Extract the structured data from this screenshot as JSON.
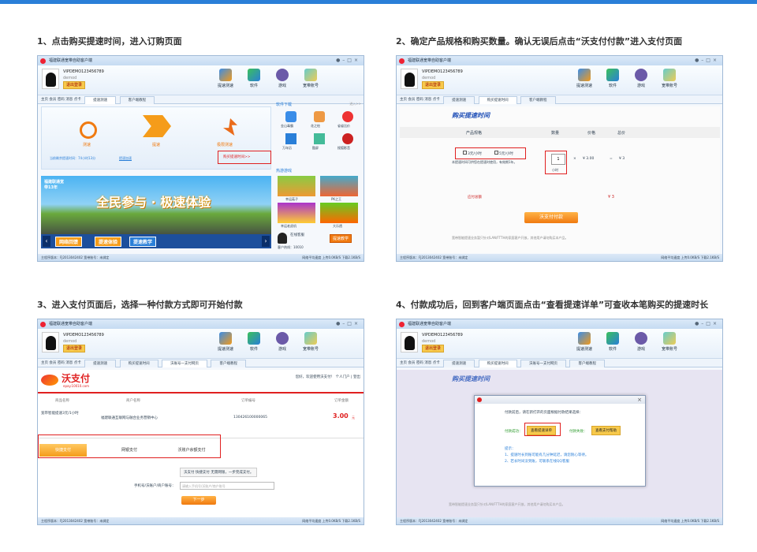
{
  "captions": {
    "step1": "1、点击购买提速时间，进入订购页面",
    "step2": "2、确定产品规格和购买数量。确认无误后点击“沃支付付款”进入支付页面",
    "step3": "3、进入支付页面后，选择一种付款方式即可开始付款",
    "step4": "4、付款成功后，回到客户端页面点击“查看提速详单”可查收本笔购买的提速时长"
  },
  "client": {
    "window_title": "福建联通宽带自助客户端",
    "account": "VIPDEMO123456789",
    "account_sub": "demod",
    "login_label": "退出登录",
    "toolbar": [
      "提速测速",
      "软件",
      "游戏",
      "宽带账号"
    ],
    "nav_links": "主页 会员 密码 消息 点卡",
    "tabs": {
      "speed_test": "提速测速",
      "customer_info": "客户端教程",
      "buy_speed_time": "购买提速时间",
      "wo_pay": "沃账号一支付网页"
    },
    "statusbar_left": "主程序版本：FJ2013042402   宽带账号：未绑定",
    "statusbar_right": "网络平均速度 上传0.0KB/S 下载2.1KB/S"
  },
  "screen1": {
    "test_label": "测速",
    "speedup_label": "提速",
    "max_label": "极限测速",
    "current_time": "当前剩余提速时间：74小时13分",
    "buy_link": "提速加速",
    "buy_btn": "购买提速时间>>",
    "software_title": "软件下载",
    "more": "进入>>",
    "apps": [
      "金山毒霸",
      "花之绘",
      "省省比价",
      "万年历",
      "酷屏",
      "搜狐影音"
    ],
    "banner_text": "全民参与 · 极速体验",
    "banner_tag": "福建联通宽带13年",
    "games_title": "热游游戏",
    "games": [
      "幸运菇子",
      "PK之王",
      "幸运老虎机",
      "大乐透"
    ],
    "bottom_btns": [
      "网络回馈",
      "提速体验",
      "提速教学"
    ],
    "service": "在线客服",
    "hotline": "客户热线：10010"
  },
  "screen2": {
    "page_title": "购买提速时间",
    "col_product": "产品规格",
    "col_qty": "数量",
    "col_price": "价格",
    "col_total": "总价",
    "opt1": "3元/小时",
    "opt2": "5元/小时",
    "note": "本提速时间可供您在提速时使用，有效期1年。",
    "qty": "1",
    "unit": "小时",
    "price": "¥ 3.00",
    "total": "¥ 3",
    "pay_total_label": "应付总额",
    "pay_total": "¥ 3",
    "pay_btn": "沃支付付款",
    "footer_note": "宽带智能提速业务暂只针对LAN/FTTH的家庭客户开放，其他用户请勿购买本产品。"
  },
  "screen3": {
    "brand": "沃支付",
    "brand_sub": "epay.10010.com",
    "greet": "您好，欢迎使用沃支付！ 个人门户 | 登出",
    "col_name": "商品名称",
    "col_merchant": "商户名称",
    "col_order": "订单编号",
    "col_amount": "订单金额",
    "row_name": "宽带智能提速3元/1小时",
    "row_merchant": "福建联通互联网与融合业务营销中心",
    "row_order": "130426100000065",
    "row_amount": "3.00",
    "row_amount_unit": "元",
    "pay_tabs": [
      "快捷支付",
      "网银支付",
      "沃账户余额支付"
    ],
    "quick_hint": "沃支付 快捷支付 无需网银，一步完成支付。",
    "card_label": "手机号/沃账户/商户账号：",
    "card_placeholder": "请输入手机号/沃账户/商户账号",
    "next_btn": "下一步"
  },
  "screen4": {
    "dialog_msg": "付款前后，请在新打开的页面根据付款结果选择：",
    "done_label": "付款成功：",
    "done_btn": "查看提速详单",
    "fail_label": "付款失败：",
    "fail_btn": "查看支付帮助",
    "tips_title": "提示：",
    "tip1": "1、提速时长到账可能有几分钟延迟，请您耐心等待。",
    "tip2": "2、若长时间没到账，可联系在线QQ客服"
  },
  "colors": {
    "accent": "#2a7fd8",
    "highlight": "#e02020",
    "orange": "#f08a20",
    "title_blue": "#1f4fb7"
  }
}
